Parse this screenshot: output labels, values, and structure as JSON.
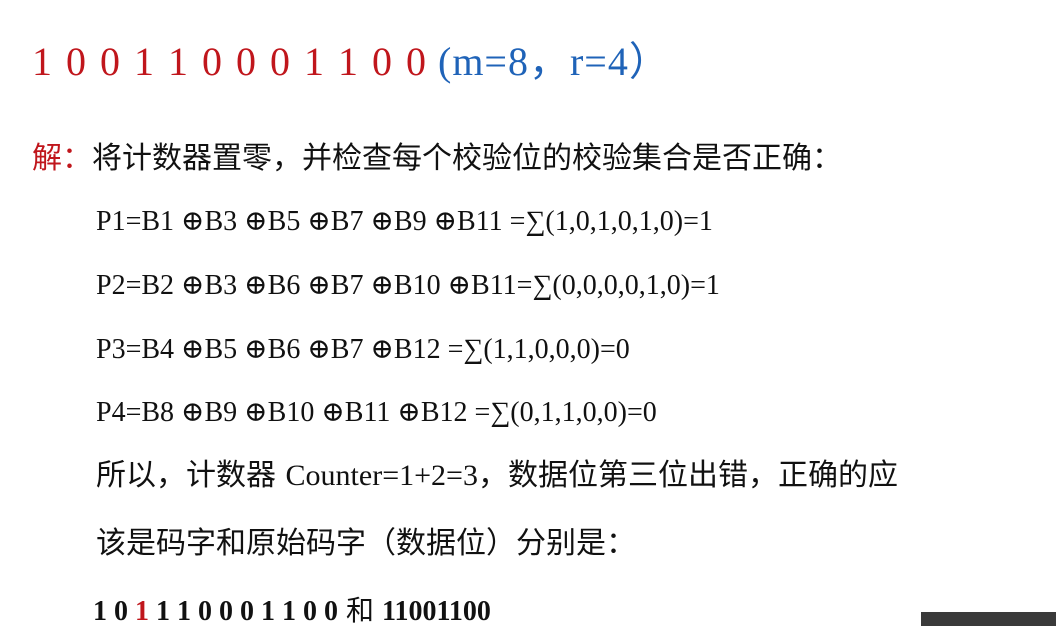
{
  "title": {
    "bits": "1 0 0 1 1 0 0 0 1 1 0 0",
    "params": "(m=8，r=4）"
  },
  "solution": {
    "label": "解：",
    "text": "将计数器置零，并检查每个校验位的校验集合是否正确："
  },
  "equations": [
    "P1=B1 ⊕B3 ⊕B5 ⊕B7 ⊕B9 ⊕B11 =∑(1,0,1,0,1,0)=1",
    "P2=B2 ⊕B3 ⊕B6 ⊕B7 ⊕B10 ⊕B11=∑(0,0,0,0,1,0)=1",
    "P3=B4 ⊕B5 ⊕B6 ⊕B7  ⊕B12 =∑(1,1,0,0,0)=0",
    "P4=B8 ⊕B9 ⊕B10 ⊕B11 ⊕B12 =∑(0,1,1,0,0)=0"
  ],
  "conclusion": {
    "line1_a": "所以，计数器 ",
    "line1_b": "Counter=1+2=3",
    "line1_c": "，数据位第三位出错，正确的应",
    "line2": "该是码字和原始码字（数据位）分别是："
  },
  "answer": {
    "codeword_pre": "1 0 ",
    "codeword_err": "1",
    "codeword_post": " 1 1 0 0 0 1 1 0 0",
    "conj": "和",
    "data": "11001100"
  },
  "colors": {
    "accent_red": "#c0161c",
    "accent_blue": "#1f63b8"
  }
}
